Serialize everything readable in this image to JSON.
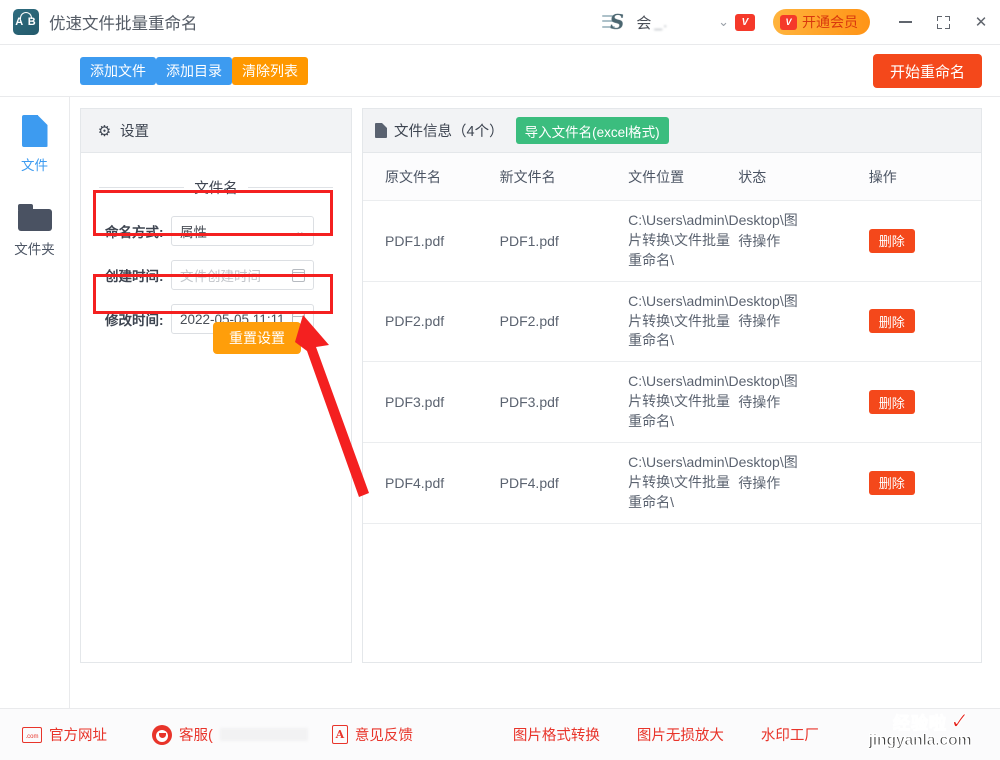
{
  "titlebar": {
    "app_title": "优速文件批量重命名",
    "logo_text": "A B",
    "username": "会",
    "vip_button": "开通会员",
    "vip_chip": "V",
    "minimize": "最小化",
    "maximize": "最大化",
    "close": "✕"
  },
  "toolbar": {
    "add_file": "添加文件",
    "add_dir": "添加目录",
    "clear_list": "清除列表",
    "start_rename": "开始重命名"
  },
  "sidebar": {
    "items": [
      {
        "label": "文件",
        "icon": "file-icon",
        "active": true
      },
      {
        "label": "文件夹",
        "icon": "folder-icon",
        "active": false
      }
    ]
  },
  "settings": {
    "header": "设置",
    "section_title": "文件名",
    "fields": [
      {
        "label": "命名方式:",
        "value": "属性",
        "placeholder": "",
        "control": "select"
      },
      {
        "label": "创建时间:",
        "value": "",
        "placeholder": "文件创建时间",
        "control": "date"
      },
      {
        "label": "修改时间:",
        "value": "2022-05-05 11:11",
        "placeholder": "",
        "control": "date"
      }
    ],
    "reset_button": "重置设置"
  },
  "filepanel": {
    "title": "文件信息（4个）",
    "import_button": "导入文件名(excel格式)",
    "columns": [
      "原文件名",
      "新文件名",
      "文件位置",
      "状态",
      "操作"
    ],
    "rows": [
      {
        "old_name": "PDF1.pdf",
        "new_name": "PDF1.pdf",
        "path": "C:\\Users\\admin\\Desktop\\图片转换\\文件批量重命名\\",
        "status": "待操作",
        "action": "删除"
      },
      {
        "old_name": "PDF2.pdf",
        "new_name": "PDF2.pdf",
        "path": "C:\\Users\\admin\\Desktop\\图片转换\\文件批量重命名\\",
        "status": "待操作",
        "action": "删除"
      },
      {
        "old_name": "PDF3.pdf",
        "new_name": "PDF3.pdf",
        "path": "C:\\Users\\admin\\Desktop\\图片转换\\文件批量重命名\\",
        "status": "待操作",
        "action": "删除"
      },
      {
        "old_name": "PDF4.pdf",
        "new_name": "PDF4.pdf",
        "path": "C:\\Users\\admin\\Desktop\\图片转换\\文件批量重命名\\",
        "status": "待操作",
        "action": "删除"
      }
    ]
  },
  "bottombar": {
    "official_site": "官方网址",
    "service": "客服(",
    "feedback": "意见反馈",
    "links": [
      "图片格式转换",
      "图片无损放大",
      "水印工厂"
    ]
  },
  "watermark": {
    "cn": "经验啦",
    "en": "jingyanla.com",
    "check": "✓"
  },
  "colors": {
    "accent_blue": "#3d9bf0",
    "accent_orange": "#ff9800",
    "accent_red": "#f4481b",
    "accent_green": "#3bbd7e",
    "annotation_red": "#f42020",
    "vip_gold": "#ff9416"
  }
}
